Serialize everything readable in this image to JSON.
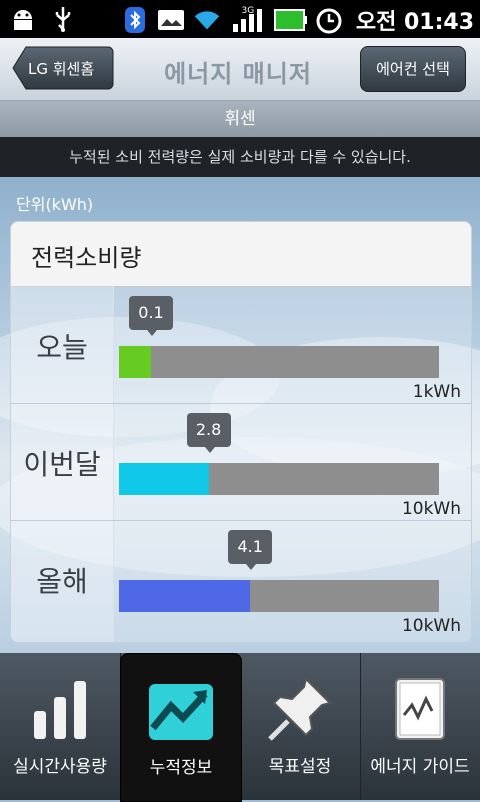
{
  "statusbar": {
    "time": "오전 01:43",
    "network": "3G"
  },
  "header": {
    "back_label": "LG 휘센홈",
    "title": "에너지 매니저",
    "ac_select_label": "에어컨 선택"
  },
  "subheader": "휘센",
  "notice": "누적된 소비 전력량은 실제 소비량과 다를 수 있습니다.",
  "unit_label": "단위(kWh)",
  "panel_title": "전력소비량",
  "rows": [
    {
      "label": "오늘",
      "value": "0.1",
      "max": "1kWh",
      "fraction": 0.1,
      "color": "#66cc22"
    },
    {
      "label": "이번달",
      "value": "2.8",
      "max": "10kWh",
      "fraction": 0.28,
      "color": "#10c8e8"
    },
    {
      "label": "올해",
      "value": "4.1",
      "max": "10kWh",
      "fraction": 0.41,
      "color": "#4f69e6"
    }
  ],
  "tabs": [
    {
      "label": "실시간사용량",
      "icon": "bar-chart-icon"
    },
    {
      "label": "누적정보",
      "icon": "trend-chart-icon"
    },
    {
      "label": "목표설정",
      "icon": "pushpin-icon"
    },
    {
      "label": "에너지 가이드",
      "icon": "guide-book-icon"
    }
  ],
  "colors": {
    "accent": "#2fd0d8",
    "bar_track": "#8e8e8e"
  }
}
